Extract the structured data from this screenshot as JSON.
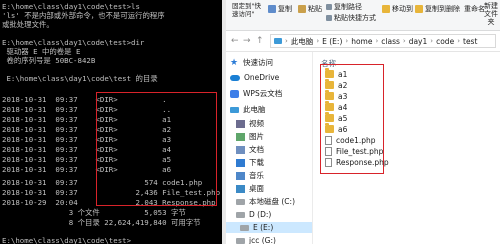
{
  "cmd": {
    "lines": [
      "E:\\home\\class\\day1\\code\\test>ls",
      "'ls' 不是内部或外部命令，也不是可运行的程序",
      "或批处理文件。",
      "",
      "E:\\home\\class\\day1\\code\\test>dir",
      " 驱动器 E 中的卷是 E",
      " 卷的序列号是 50BC-842B",
      "",
      " E:\\home\\class\\day1\\code\\test 的目录",
      "",
      "2018-10-31  09:37    <DIR>          .",
      "2018-10-31  09:37    <DIR>          ..",
      "2018-10-31  09:37    <DIR>          a1",
      "2018-10-31  09:37    <DIR>          a2",
      "2018-10-31  09:37    <DIR>          a3",
      "2018-10-31  09:37    <DIR>          a4",
      "2018-10-31  09:37    <DIR>          a5",
      "2018-10-31  09:37    <DIR>          a6",
      "2018-10-31  09:37               574 code1.php",
      "2018-10-31  09:37             2,436 File_test.php",
      "2018-10-29  20:04             2,043 Response.php",
      "               3 个文件          5,053 字节",
      "               8 个目录 22,624,419,840 可用字节",
      "",
      "E:\\home\\class\\day1\\code\\test>"
    ]
  },
  "ribbon": {
    "pin_label": "固定到\"快速访问\"",
    "copy_label": "复制",
    "paste_label": "粘贴",
    "copy_path_label": "复制路径",
    "paste_shortcut_label": "粘贴快捷方式",
    "move_to_label": "移动到",
    "copy_to_label": "复制到",
    "delete_label": "删除",
    "rename_label": "重命名",
    "new_folder_label": "新建\n文件夹"
  },
  "address": {
    "segments": [
      "此电脑",
      "E (E:)",
      "home",
      "class",
      "day1",
      "code",
      "test"
    ]
  },
  "nav": {
    "items": [
      {
        "label": "快速访问",
        "icon": "star-icon"
      },
      {
        "label": "OneDrive",
        "icon": "cloud-icon"
      },
      {
        "label": "WPS云文档",
        "icon": "wps-icon"
      },
      {
        "label": "此电脑",
        "icon": "pc-icon"
      },
      {
        "label": "视频",
        "icon": "video-icon"
      },
      {
        "label": "图片",
        "icon": "image-icon"
      },
      {
        "label": "文档",
        "icon": "document-icon"
      },
      {
        "label": "下载",
        "icon": "download-icon"
      },
      {
        "label": "音乐",
        "icon": "music-icon"
      },
      {
        "label": "桌面",
        "icon": "desktop-icon"
      },
      {
        "label": "本地磁盘 (C:)",
        "icon": "drive-icon"
      },
      {
        "label": "D (D:)",
        "icon": "drive-icon"
      },
      {
        "label": "E (E:)",
        "icon": "drive-icon"
      },
      {
        "label": "jcc (G:)",
        "icon": "drive-icon"
      }
    ]
  },
  "content": {
    "column_header": "名称",
    "files": [
      {
        "name": "a1",
        "kind": "folder"
      },
      {
        "name": "a2",
        "kind": "folder"
      },
      {
        "name": "a3",
        "kind": "folder"
      },
      {
        "name": "a4",
        "kind": "folder"
      },
      {
        "name": "a5",
        "kind": "folder"
      },
      {
        "name": "a6",
        "kind": "folder"
      },
      {
        "name": "code1.php",
        "kind": "file"
      },
      {
        "name": "File_test.php",
        "kind": "file"
      },
      {
        "name": "Response.php",
        "kind": "file"
      }
    ]
  },
  "colors": {
    "highlight_box": "#d8232a",
    "terminal_bg": "#000000",
    "terminal_fg": "#c0c0c0",
    "folder": "#e8b53a",
    "selected_nav": "#cce8ff"
  }
}
